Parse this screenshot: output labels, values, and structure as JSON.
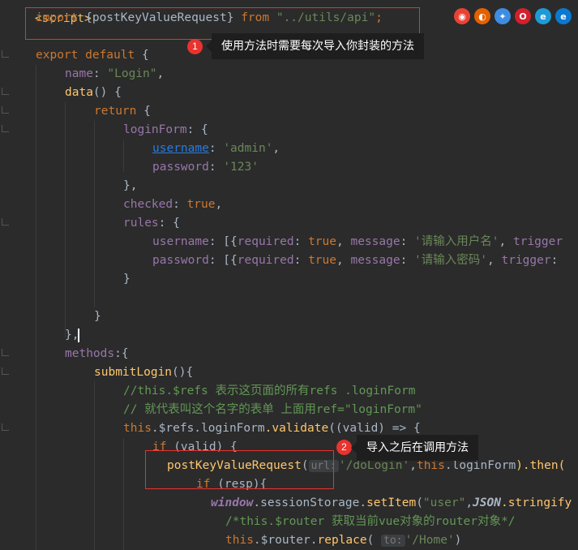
{
  "browsers": [
    {
      "icon": "chrome-icon",
      "color": "#e94235"
    },
    {
      "icon": "firefox-icon",
      "color": "#e66000"
    },
    {
      "icon": "safari-icon",
      "color": "#3d8de2"
    },
    {
      "icon": "opera-icon",
      "color": "#d4202c"
    },
    {
      "icon": "ie-icon",
      "color": "#1e9bd7"
    },
    {
      "icon": "edge-icon",
      "color": "#0a79d2"
    }
  ],
  "annotations": {
    "n1": "1",
    "t1": "使用方法时需要每次导入你封装的方法",
    "n2": "2",
    "t2": "导入之后在调用方法"
  },
  "code": {
    "l0": "<script>",
    "import_kw": "import",
    "import_name": " {postKeyValueRequest} ",
    "from_kw": "from",
    "import_path": "\"../utils/api\"",
    "import_semi": ";",
    "export_kw": "export default",
    "export_brace": " {",
    "name_key": "name",
    "name_val": "\"Login\"",
    "data_fn": "data",
    "data_rest": "() {",
    "return_kw": "return",
    "return_brace": " {",
    "loginform_key": "loginForm",
    "loginform_rest": ": {",
    "username_key": "username",
    "username_val": "'admin'",
    "password_key": "password",
    "password_val": "'123'",
    "close_brace_comma": "},",
    "checked_key": "checked",
    "checked_val": "true",
    "rules_key": "rules",
    "rules_rest": ": {",
    "rule1_key": "username",
    "rule1_pre": ": [{",
    "required": "required",
    "true_kw": "true",
    "message": "message",
    "rule1_msg": "'请输入用户名'",
    "trigger": "trigger",
    "rule2_key": "password",
    "rule2_msg": "'请输入密码'",
    "close_brace": "}",
    "close_brace2": "}",
    "close_outer": "},",
    "methods_key": "methods",
    "methods_rest": ":{",
    "submit_fn": "submitLogin",
    "submit_rest": "(){",
    "comment1": "//this.$refs 表示这页面的所有refs .loginForm",
    "comment2": "// 就代表叫这个名字的表单 上面用ref=\"loginForm\"",
    "validate_this": "this",
    "validate_mid": ".$refs.",
    "validate_form": "loginForm",
    "validate_call": ".validate",
    "validate_rest": "((valid) => {",
    "if_kw": "if",
    "if_rest": " (valid) {",
    "call_fn": "postKeyValueRequest",
    "call_open": "(",
    "hint_url": "url:",
    "call_arg": "'/doLogin'",
    "call_this": "this",
    "call_form": ".loginForm",
    "call_then": ").then(",
    "if2_rest": " (resp){",
    "window_kw": "window",
    "session": ".sessionStorage.",
    "setitem": "setItem",
    "setitem_arg": "\"user\"",
    "json_kw": "JSON",
    "stringify": ".stringify",
    "comment3": "/*this.$router 获取当前vue对象的router对象*/",
    "router_this": "this",
    "router_mid": ".$router.",
    "replace": "replace",
    "hint_to": "to:",
    "router_arg": "'/Home'",
    "router_close": ")"
  }
}
